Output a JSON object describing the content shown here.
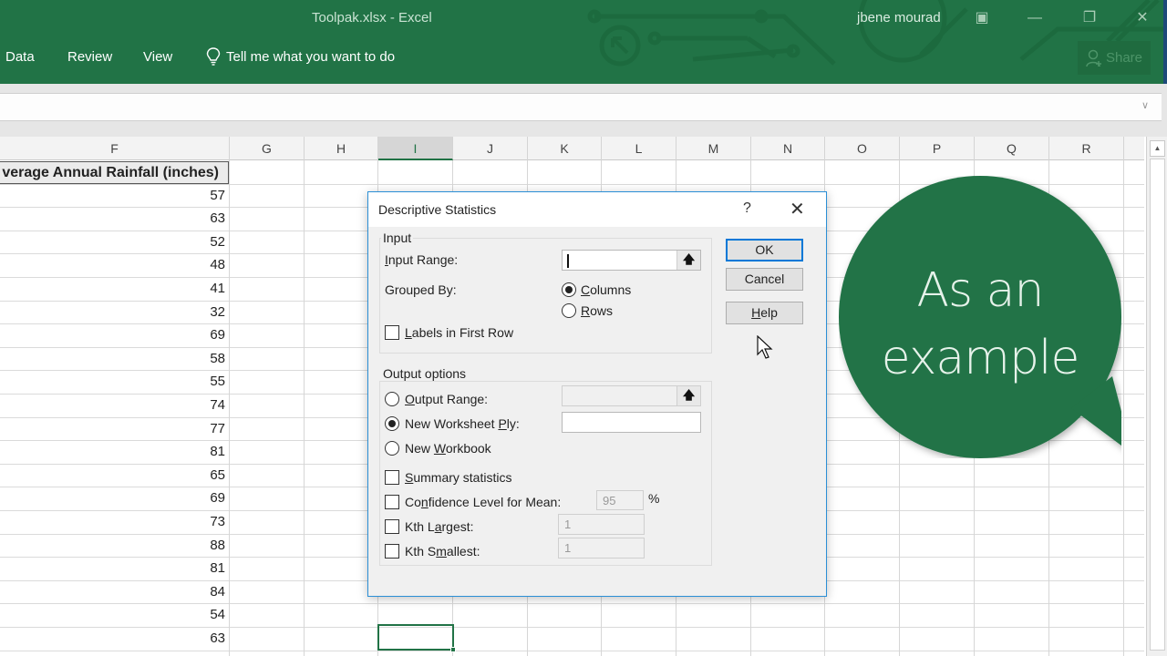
{
  "window": {
    "title": "Toolpak.xlsx  -  Excel",
    "user": "jbene mourad",
    "controls": {
      "ribbon_display": "▣",
      "minimize": "—",
      "restore": "❐",
      "close": "✕"
    },
    "accent_color": "#217346"
  },
  "ribbon": {
    "tabs": [
      {
        "label": "Data"
      },
      {
        "label": "Review"
      },
      {
        "label": "View"
      }
    ],
    "tell_me": {
      "icon": "lightbulb-icon",
      "label": "Tell me what you want to do"
    },
    "share": {
      "icon": "person-add-icon",
      "label": "Share"
    }
  },
  "sheet": {
    "columns": [
      "F",
      "G",
      "H",
      "I",
      "J",
      "K",
      "L",
      "M",
      "N",
      "O",
      "P",
      "Q",
      "R"
    ],
    "selected_column": "I",
    "header_cell": "verage Annual Rainfall (inches)",
    "values": [
      57,
      63,
      52,
      48,
      41,
      32,
      69,
      58,
      55,
      74,
      77,
      81,
      65,
      69,
      73,
      88,
      81,
      84,
      54,
      63
    ]
  },
  "dialog": {
    "title": "Descriptive Statistics",
    "help_glyph": "?",
    "close_glyph": "✕",
    "input_group": {
      "label": "Input",
      "input_range_label": "Input Range:",
      "input_range_value": "",
      "grouped_by_label": "Grouped By:",
      "grouped_by_options": [
        {
          "label": "Columns",
          "checked": true
        },
        {
          "label": "Rows",
          "checked": false
        }
      ],
      "labels_first_row": {
        "label": "Labels in First Row",
        "checked": false
      }
    },
    "output_group": {
      "label": "Output options",
      "destinations": [
        {
          "label": "Output Range:",
          "checked": false,
          "value": ""
        },
        {
          "label": "New Worksheet Ply:",
          "checked": true,
          "value": ""
        },
        {
          "label": "New Workbook",
          "checked": false
        }
      ],
      "summary_statistics": {
        "label": "Summary statistics",
        "checked": false
      },
      "confidence_level": {
        "label": "Confidence Level for Mean:",
        "checked": false,
        "value": "95",
        "unit": "%"
      },
      "kth_largest": {
        "label": "Kth Largest:",
        "checked": false,
        "value": "1"
      },
      "kth_smallest": {
        "label": "Kth Smallest:",
        "checked": false,
        "value": "1"
      }
    },
    "buttons": {
      "ok": "OK",
      "cancel": "Cancel",
      "help": "Help"
    }
  },
  "callout": {
    "line1": "As an",
    "line2": "example",
    "color": "#217346"
  }
}
